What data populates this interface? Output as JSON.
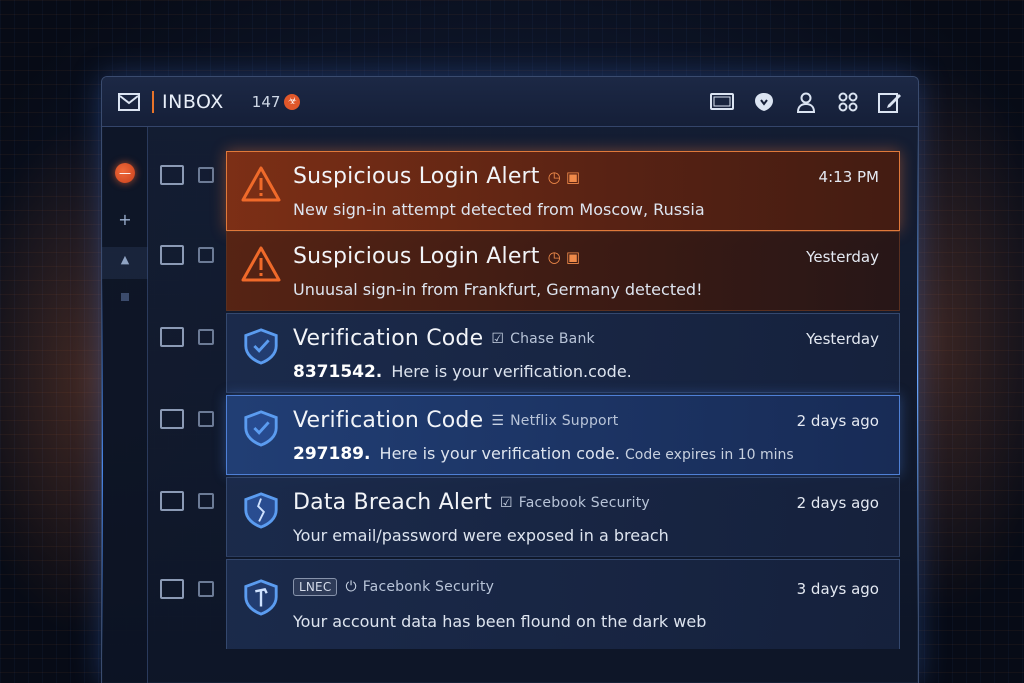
{
  "toolbar": {
    "title": "INBOX",
    "count": "147",
    "icons": [
      "envelope-icon",
      "window-icon",
      "shield-heart-icon",
      "user-icon",
      "link-icon",
      "compose-icon"
    ]
  },
  "sidebar": {
    "items": [
      "compose-dot-icon",
      "plus-icon",
      "upload-icon",
      "square-icon"
    ]
  },
  "emails": [
    {
      "title": "Suspicious Login Alert",
      "time": "4:13 PM",
      "preview": "New sign-in attempt detected from Moscow, Russia",
      "icon": "warning-triangle-icon",
      "style": "alert-hot"
    },
    {
      "title": "Suspicious Login Alert",
      "time": "Yesterday",
      "preview": "Unuusal sign-in from Frankfurt, Germany detected!",
      "icon": "warning-triangle-icon",
      "style": "alert"
    },
    {
      "title": "Verification Code",
      "sender": "Chase Bank",
      "time": "Yesterday",
      "code": "8371542.",
      "preview": "Here is your verification.code.",
      "icon": "shield-check-icon",
      "style": "blue"
    },
    {
      "title": "Verification Code",
      "sender": "Netflix Support",
      "time": "2 days ago",
      "code": "297189.",
      "preview": "Here is your verification code.",
      "preview_small": "Code expires in 10 mins",
      "icon": "shield-check-icon",
      "style": "blue-hot"
    },
    {
      "title": "Data Breach Alert",
      "sender": "Facebook Security",
      "time": "2 days ago",
      "preview": "Your email/password were exposed in a breach",
      "icon": "shield-breach-icon",
      "style": "blue"
    },
    {
      "title": "LNEC",
      "sender": "Facebonk Security",
      "time": "3 days ago",
      "preview": "Your account data has been flound on the dark web",
      "icon": "shield-hammer-icon",
      "style": "blue"
    }
  ],
  "colors": {
    "accent_orange": "#e0793a",
    "accent_blue": "#4f80d6",
    "badge": "#e0572a"
  }
}
